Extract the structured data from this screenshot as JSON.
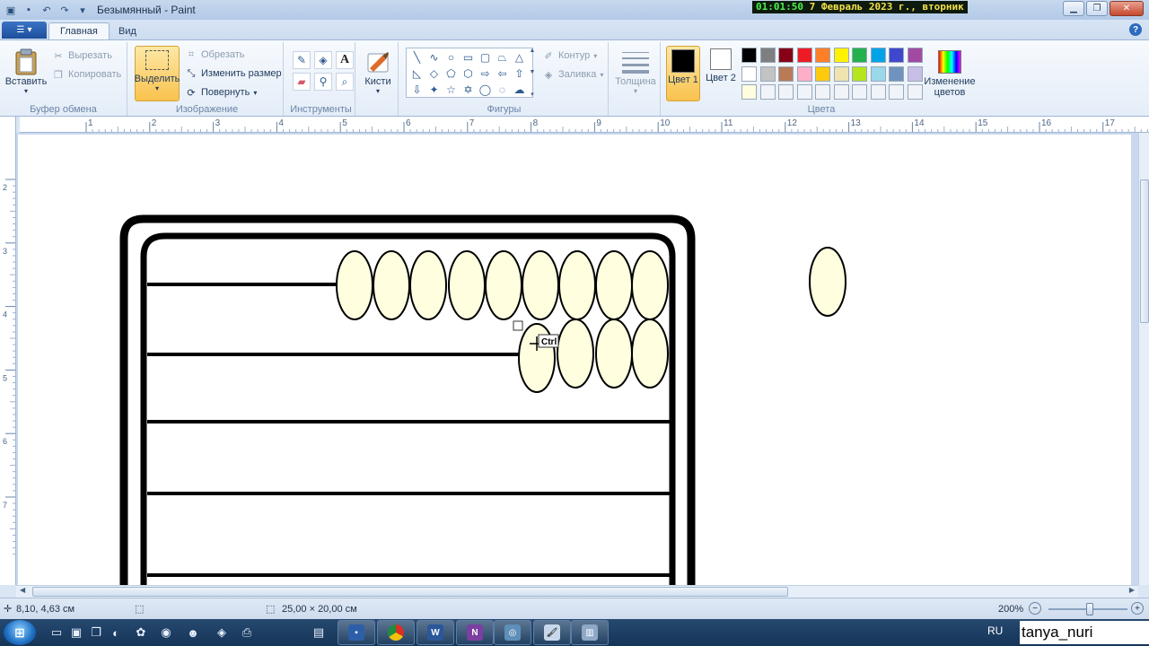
{
  "window": {
    "title": "Безымянный - Paint",
    "clock_time": "01:01:50",
    "clock_date": "7 Февраль 2023 г., вторник"
  },
  "tabs": [
    "Главная",
    "Вид"
  ],
  "ribbon": {
    "clipboard": {
      "title": "Буфер обмена",
      "paste": "Вставить",
      "cut": "Вырезать",
      "copy": "Копировать"
    },
    "image": {
      "title": "Изображение",
      "select": "Выделить",
      "crop": "Обрезать",
      "resize": "Изменить размер",
      "rotate": "Повернуть"
    },
    "tools": {
      "title": "Инструменты"
    },
    "brushes": {
      "label": "Кисти"
    },
    "shapes": {
      "title": "Фигуры",
      "outline": "Контур",
      "fill": "Заливка"
    },
    "size": {
      "label": "Толщина"
    },
    "colors": {
      "title": "Цвета",
      "color1": "Цвет 1",
      "color2": "Цвет 2",
      "edit": "Изменение цветов",
      "color1_value": "#000000",
      "color2_value": "#ffffff",
      "palette": [
        "#000000",
        "#7f7f7f",
        "#880015",
        "#ed1c24",
        "#ff7f27",
        "#fff200",
        "#22b14c",
        "#00a2e8",
        "#3f48cc",
        "#a349a4",
        "#ffffff",
        "#c3c3c3",
        "#b97a57",
        "#ffaec9",
        "#ffc90e",
        "#efe4b0",
        "#b5e61d",
        "#99d9ea",
        "#7092be",
        "#c8bfe7",
        "#fffde0",
        "#f0f3f8",
        "#f0f3f8",
        "#f0f3f8",
        "#f0f3f8",
        "#f0f3f8",
        "#f0f3f8",
        "#f0f3f8",
        "#f0f3f8",
        "#f0f3f8"
      ]
    }
  },
  "rulers": {
    "h_labels": [
      "1",
      "2",
      "3",
      "4",
      "5",
      "6",
      "7",
      "8",
      "9",
      "10",
      "11",
      "12",
      "13",
      "14",
      "15",
      "16",
      "17"
    ],
    "v_labels": [
      "2",
      "3",
      "4",
      "5",
      "6",
      "7"
    ]
  },
  "canvas": {
    "bead_fill": "#ffffe0",
    "ctrl_tooltip": "Ctrl"
  },
  "status": {
    "cursor_pos": "8,10, 4,63 см",
    "canvas_size": "25,00 × 20,00 см",
    "zoom": "200%"
  },
  "taskbar": {
    "language": "RU",
    "username": "tanya_nuri"
  }
}
